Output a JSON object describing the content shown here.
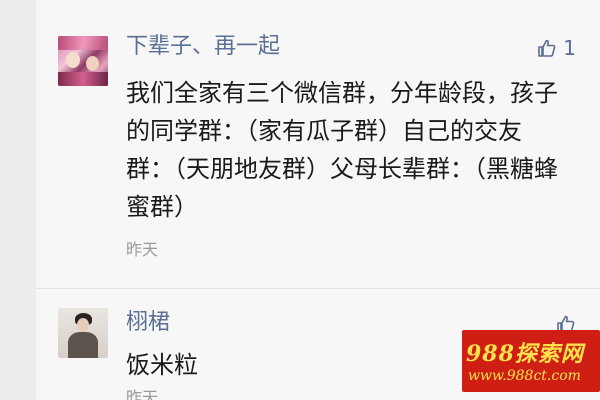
{
  "comments": [
    {
      "author": "下辈子、再一起",
      "text": "我们全家有三个微信群，分年龄段，孩子的同学群：（家有瓜子群）自己的交友群：（天朋地友群）父母长辈群：（黑糖蜂蜜群）",
      "time": "昨天",
      "likes": "1",
      "like_icon": "thumbs-up-icon",
      "avatar_icon": "avatar-photo"
    },
    {
      "author": "栩桾",
      "text": "饭米粒",
      "time": "昨天",
      "like_icon": "thumbs-up-icon",
      "avatar_icon": "avatar-photo"
    }
  ],
  "watermark": {
    "line1": "988探索网",
    "line2": "www.988ct.com"
  },
  "colors": {
    "author_name": "#5a6f94",
    "timestamp": "#9a9a9a",
    "background": "#f7f7f7",
    "watermark_bg": "#cf1f14",
    "watermark_text": "#ffe14a"
  }
}
